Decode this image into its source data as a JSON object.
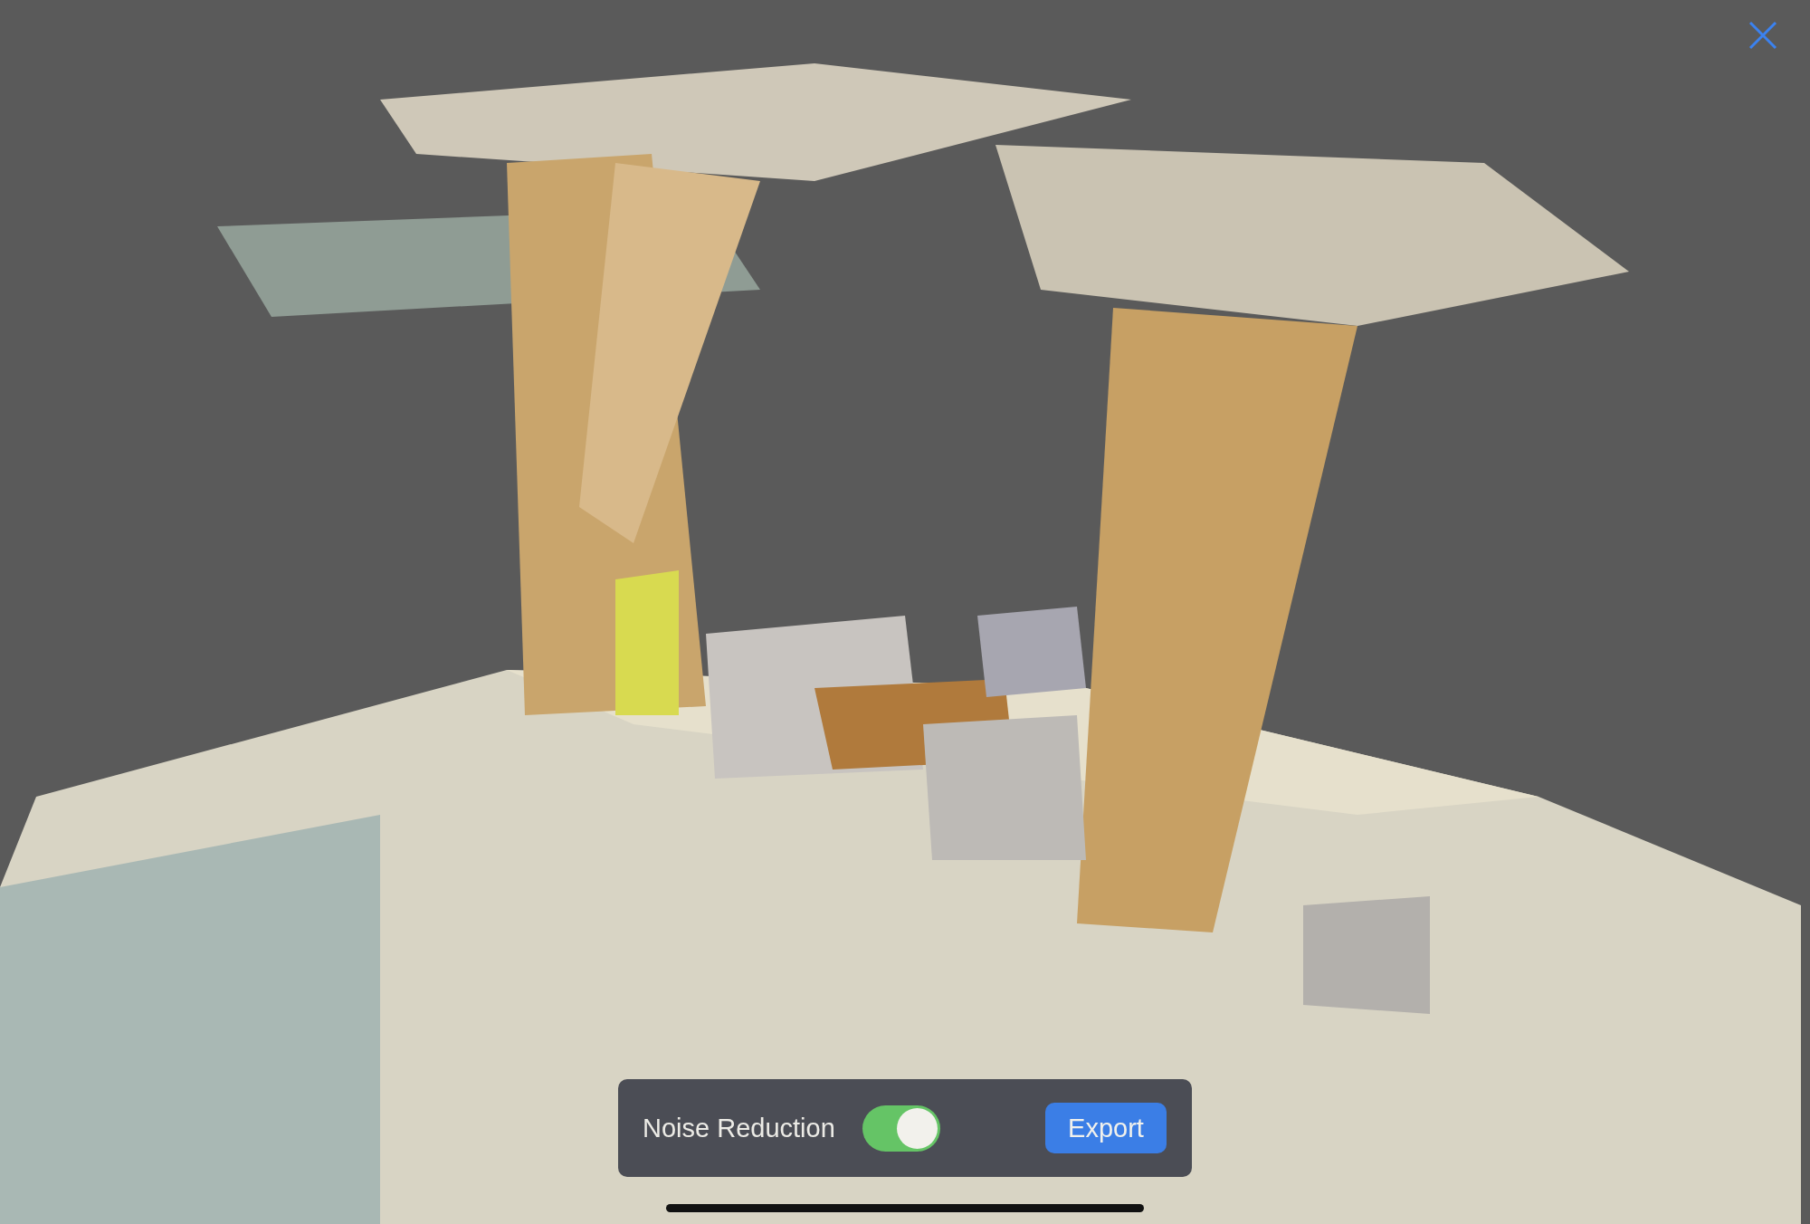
{
  "toolbar": {
    "label": "Noise Reduction",
    "noise_reduction": {
      "on": true
    },
    "export_button": "Export"
  }
}
